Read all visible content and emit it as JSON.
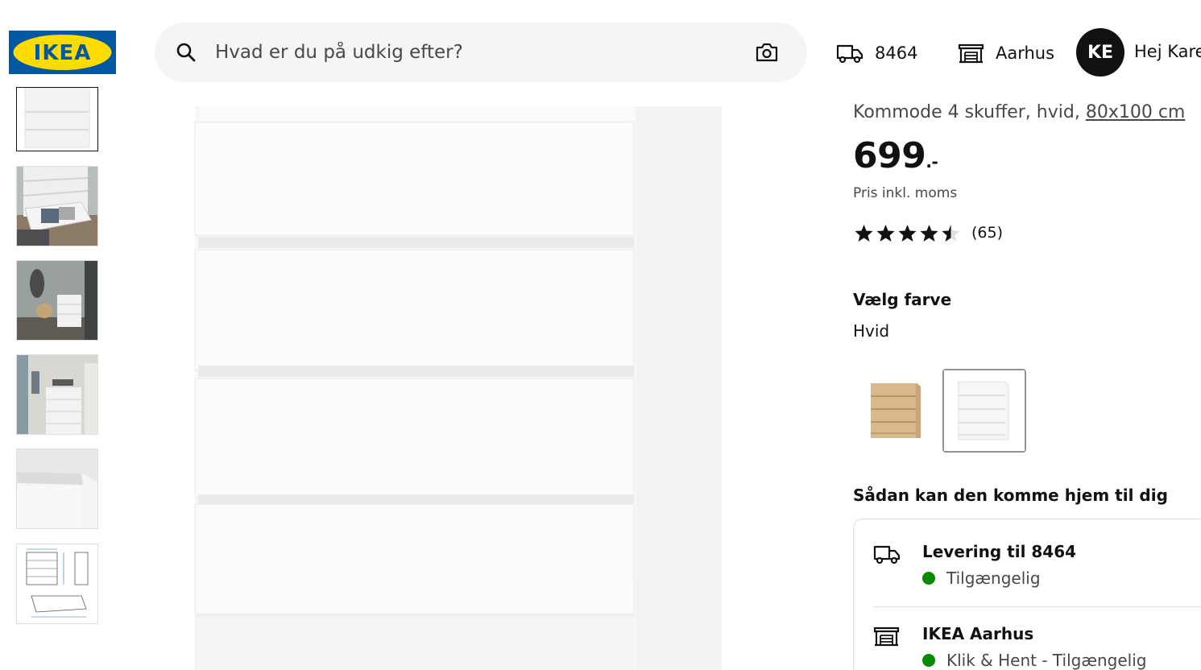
{
  "header": {
    "logo_text": "IKEA",
    "search_placeholder": "Hvad er du på udkig efter?",
    "delivery_postcode": "8464",
    "store_name": "Aarhus",
    "avatar_initials": "KE",
    "greeting": "Hej Kare"
  },
  "product": {
    "subtitle": "Kommode 4 skuffer, hvid, ",
    "size_link": "80x100 cm",
    "price": "699",
    "price_suffix": ".-",
    "price_note": "Pris inkl. moms",
    "rating_value": 4.5,
    "rating_count": "(65)",
    "color_label": "Vælg farve",
    "color_value": "Hvid",
    "swatches": [
      {
        "name": "oak-swatch",
        "selected": false
      },
      {
        "name": "white-swatch",
        "selected": true
      }
    ]
  },
  "delivery": {
    "heading": "Sådan kan den komme hjem til dig",
    "options": [
      {
        "title": "Levering til 8464",
        "status": "Tilgængelig"
      },
      {
        "title": "IKEA Aarhus",
        "status": "Klik & Hent - Tilgængelig"
      }
    ]
  },
  "thumbnails": [
    "product-front",
    "drawer-open-lifestyle",
    "bedroom-lifestyle",
    "hallway-lifestyle",
    "top-corner-detail",
    "measurements-drawing"
  ],
  "colors": {
    "ikea_blue": "#0058a3",
    "ikea_yellow": "#ffdb00",
    "status_green": "#0a8a00"
  }
}
